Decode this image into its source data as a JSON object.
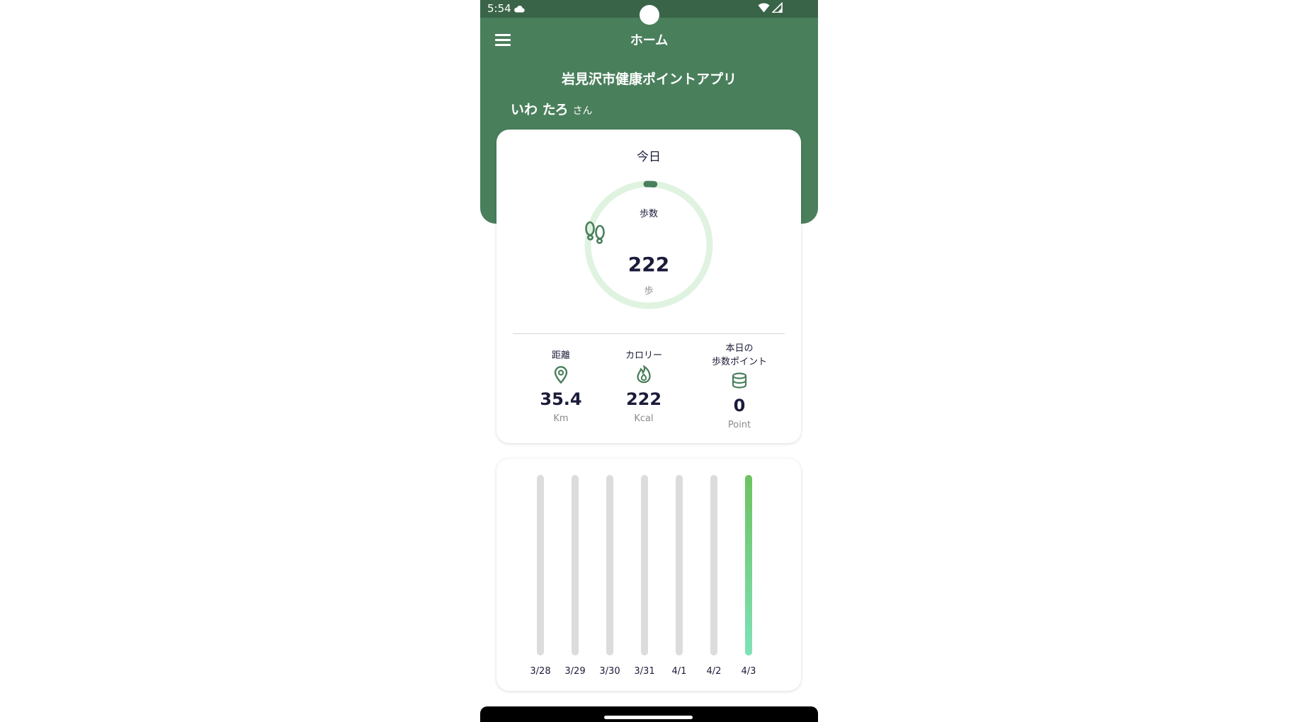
{
  "status_bar": {
    "time": "5:54"
  },
  "app_bar": {
    "title": "ホーム"
  },
  "header": {
    "app_name": "岩見沢市健康ポイントアプリ",
    "user_name": "いわ たろ",
    "user_suffix": "さん"
  },
  "today": {
    "label": "今日",
    "steps_label": "歩数",
    "steps_value": "222",
    "steps_unit": "歩",
    "steps_progress_fraction": 0.02,
    "stats": [
      {
        "label": "距離",
        "icon": "location-pin-icon",
        "value": "35.4",
        "unit": "Km"
      },
      {
        "label": "カロリー",
        "icon": "flame-icon",
        "value": "222",
        "unit": "Kcal"
      },
      {
        "label": "本日の\n歩数ポイント",
        "label_line1": "本日の",
        "label_line2": "歩数ポイント",
        "icon": "coin-stack-icon",
        "value": "0",
        "unit": "Point"
      }
    ]
  },
  "colors": {
    "primary": "#4a7f5c",
    "status_bar": "#3a6448",
    "ring_track": "#dff3e0",
    "text_dark": "#1b1b3a",
    "bar_track": "#dcdcdc",
    "bar_fill_top": "#6cc35e",
    "bar_fill_bottom": "#7ee2b8"
  },
  "chart_data": {
    "type": "bar",
    "categories": [
      "3/28",
      "3/29",
      "3/30",
      "3/31",
      "4/1",
      "4/2",
      "4/3"
    ],
    "values": [
      0,
      0,
      0,
      0,
      0,
      0,
      222
    ],
    "ylim": [
      0,
      222
    ],
    "grid": false
  }
}
